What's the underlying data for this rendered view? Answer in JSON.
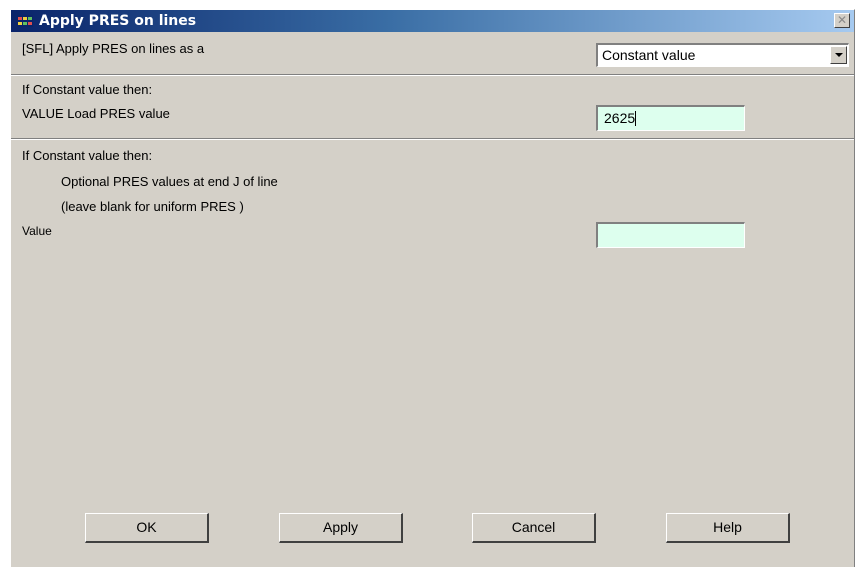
{
  "window": {
    "title": "Apply PRES on lines",
    "close_glyph": "✕"
  },
  "row_sfl": {
    "label": "[SFL] Apply PRES on lines as a",
    "dropdown_value": "Constant value"
  },
  "section_value": {
    "heading": "If Constant value then:",
    "label": "VALUE  Load PRES value",
    "input_value": "2625"
  },
  "section_optional": {
    "heading": "If Constant value then:",
    "line1": "Optional PRES values at end J of line",
    "line2": "(leave blank for uniform PRES )",
    "value_label": "Value",
    "input_value": ""
  },
  "buttons": {
    "ok": "OK",
    "apply": "Apply",
    "cancel": "Cancel",
    "help": "Help"
  },
  "colors": {
    "dialog_bg": "#d4d0c8",
    "title_gradient_start": "#0a246a",
    "title_gradient_end": "#a6caf0",
    "input_bg": "#ddffee"
  }
}
